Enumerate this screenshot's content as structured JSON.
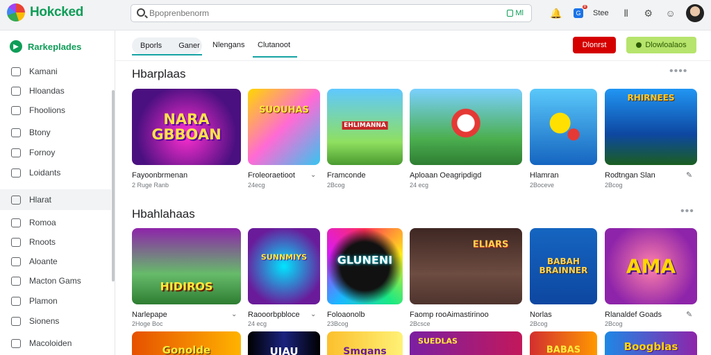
{
  "header": {
    "brand": "Hokcked",
    "search_placeholder": "Bpoprenbenorm",
    "search_chip": "Ml",
    "badge_count": "8",
    "account_label": "Stee"
  },
  "sidebar": {
    "title": "Rarkeplades",
    "items": [
      {
        "label": "Kamani"
      },
      {
        "label": "Hloandas"
      },
      {
        "label": "Fhoolions"
      },
      {
        "label": "Btony"
      },
      {
        "label": "Fornoy"
      },
      {
        "label": "Loidants"
      },
      {
        "label": "Hlarat"
      },
      {
        "label": "Romoa"
      },
      {
        "label": "Rnoots"
      },
      {
        "label": "Aloante"
      },
      {
        "label": "Macton Gams"
      },
      {
        "label": "Plamon"
      },
      {
        "label": "Sionens"
      },
      {
        "label": "Macoloiden"
      }
    ]
  },
  "tabs": {
    "seg_left": "Bporls",
    "seg_right": "Ganer",
    "tab_3": "Nlengans",
    "tab_4": "Clutanoot"
  },
  "buttons": {
    "red": "Dlonrst",
    "green": "Dlowloalaos"
  },
  "sections": [
    {
      "title": "Hbarplaas",
      "games": [
        {
          "art_text": "NARA\nGBBOAN",
          "title": "Fayoonbrmenan",
          "sub": "2 Ruge Ranb"
        },
        {
          "art_text": "SUOUHAS",
          "title": "Froleoraetioot",
          "sub": "24ecg"
        },
        {
          "art_text": "EHLIMANNA",
          "title": "Framconde",
          "sub": "2Bcog"
        },
        {
          "art_text": "",
          "title": "Aploaan Oeagripdigd",
          "sub": "24 ecg"
        },
        {
          "art_text": "",
          "title": "Hlamran",
          "sub": "2Boceve"
        },
        {
          "art_text": "RHIRNEES",
          "title": "Rodtngan Slan",
          "sub": "2Bcog"
        }
      ]
    },
    {
      "title": "Hbahlahaas",
      "games": [
        {
          "art_text": "HIDIROS",
          "title": "Narlepape",
          "sub": "2Hoge Boc"
        },
        {
          "art_text": "SUNNMIYS",
          "title": "Raooorbpbloce",
          "sub": "24 ecg"
        },
        {
          "art_text": "GLUNENI",
          "title": "Foloaonolb",
          "sub": "23Bcog"
        },
        {
          "art_text": "ELIARS",
          "title": "Faomp rooAimastirinoo",
          "sub": "2Bcsce"
        },
        {
          "art_text": "BABAH\nBRAINNER",
          "title": "Norlas",
          "sub": "2Bcog"
        },
        {
          "art_text": "AMA",
          "title": "Rlanaldef Goads",
          "sub": "2Bcog"
        }
      ]
    },
    {
      "title": "",
      "games": [
        {
          "art_text": "Gonolde"
        },
        {
          "art_text": "UIAU"
        },
        {
          "art_text": "Smgans"
        },
        {
          "art_text": "SUEDLAS"
        },
        {
          "art_text": "BABAS"
        },
        {
          "art_text": "Boogblas"
        }
      ]
    }
  ],
  "colors": {
    "brand_green": "#0f9d58",
    "accent_teal": "#16a3a3",
    "button_red": "#d50000",
    "button_green": "#b6e46c"
  }
}
